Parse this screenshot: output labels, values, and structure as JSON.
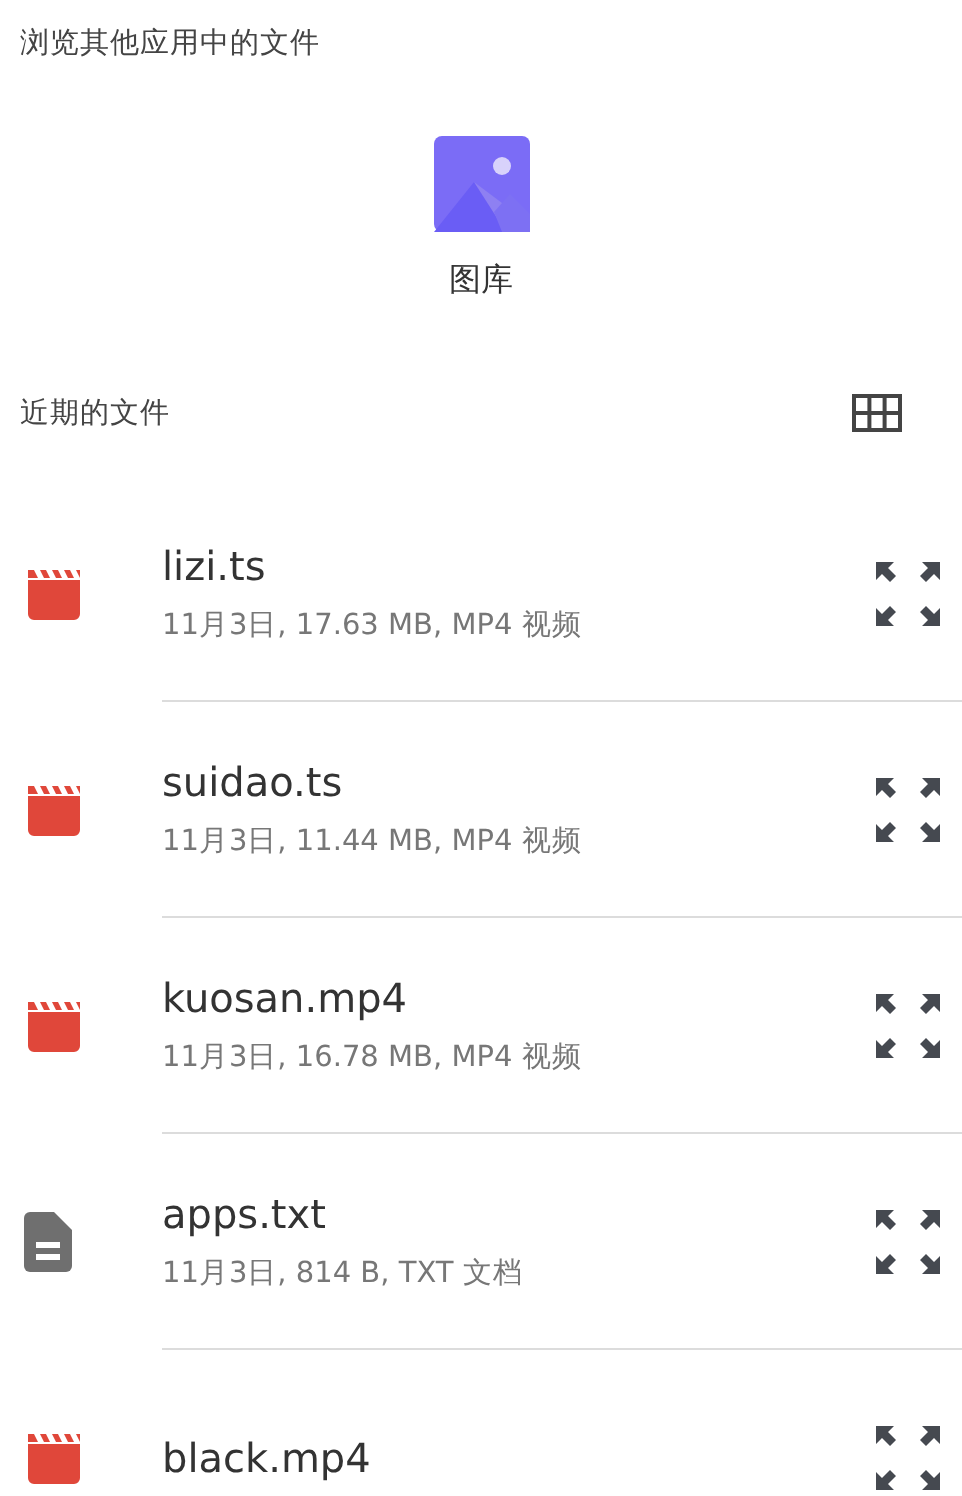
{
  "other_apps": {
    "heading": "浏览其他应用中的文件",
    "apps": [
      {
        "label": "图库",
        "kind": "gallery"
      }
    ]
  },
  "recent": {
    "heading": "近期的文件",
    "files": [
      {
        "name": "lizi.ts",
        "meta": "11月3日, 17.63 MB, MP4 视频",
        "kind": "video"
      },
      {
        "name": "suidao.ts",
        "meta": "11月3日, 11.44 MB, MP4 视频",
        "kind": "video"
      },
      {
        "name": "kuosan.mp4",
        "meta": "11月3日, 16.78 MB, MP4 视频",
        "kind": "video"
      },
      {
        "name": "apps.txt",
        "meta": "11月3日, 814 B, TXT 文档",
        "kind": "document"
      },
      {
        "name": "black.mp4",
        "kind": "video"
      }
    ]
  }
}
